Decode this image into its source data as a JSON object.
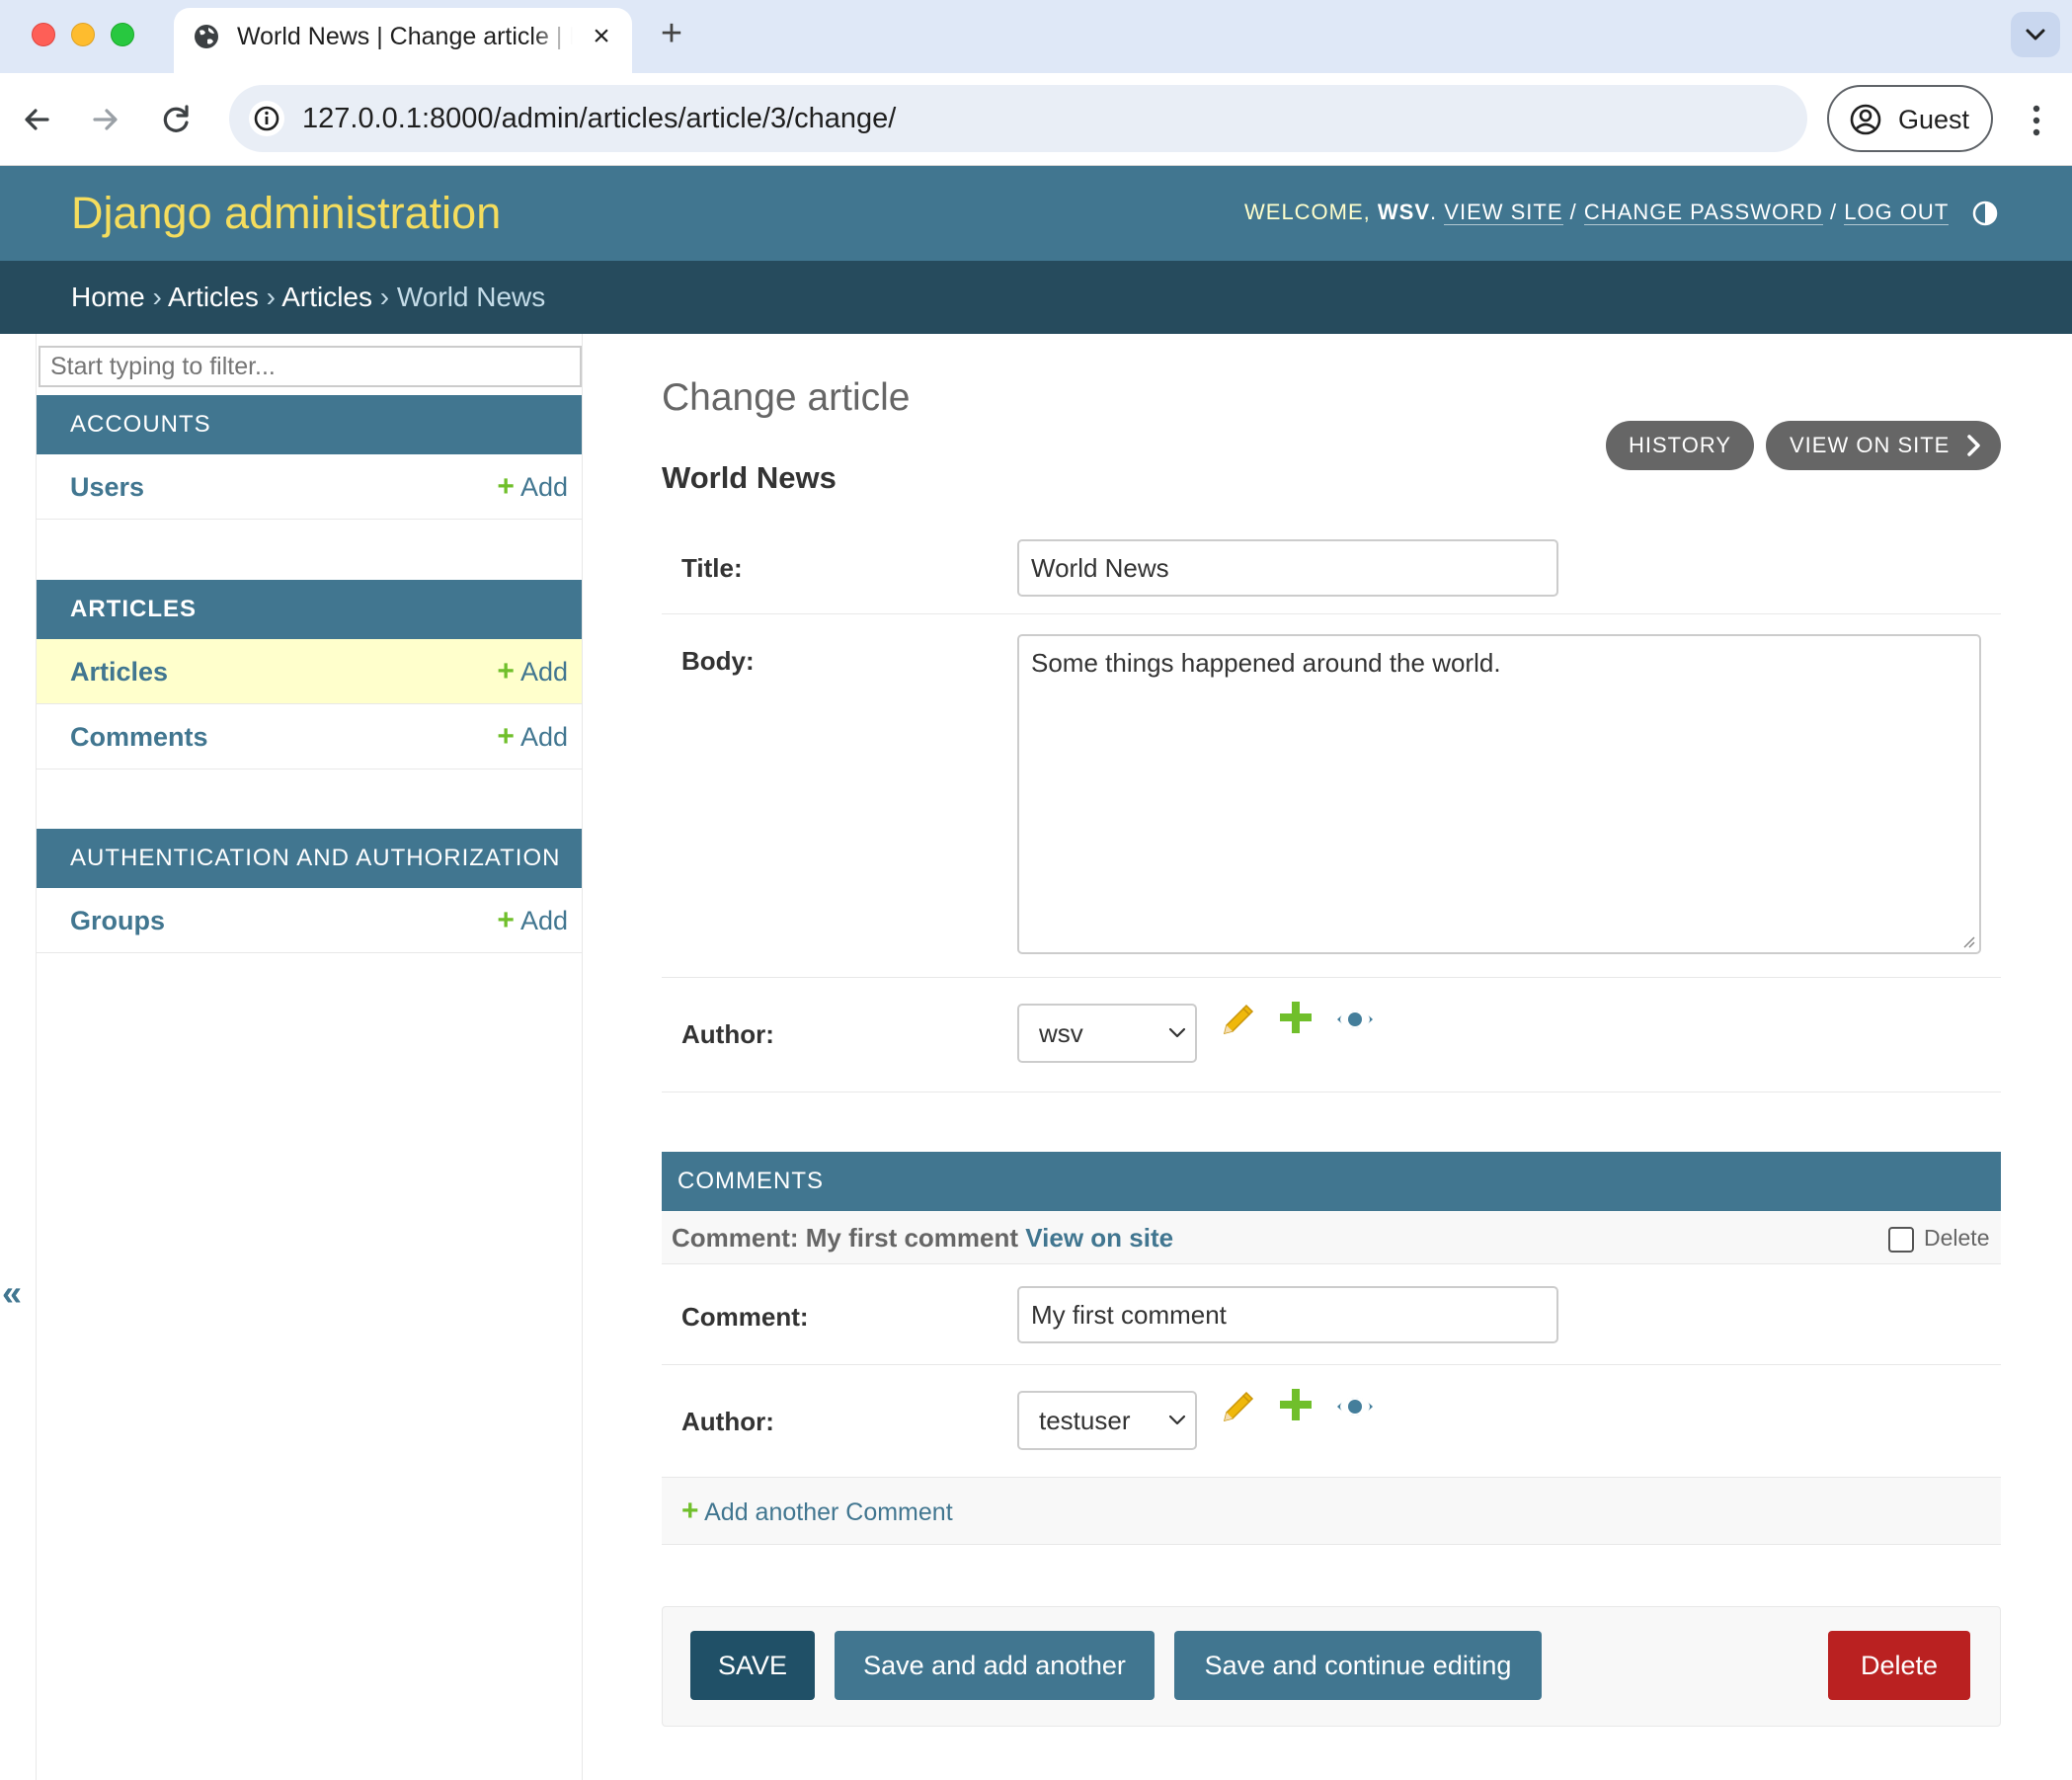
{
  "browser": {
    "tab_title": "World News | Change article | Django site admin",
    "url": "127.0.0.1:8000/admin/articles/article/3/change/",
    "profile_label": "Guest"
  },
  "header": {
    "branding": "Django administration",
    "welcome": "WELCOME,",
    "username": "WSV",
    "view_site": "VIEW SITE",
    "change_password": "CHANGE PASSWORD",
    "log_out": "LOG OUT"
  },
  "breadcrumbs": {
    "home": "Home",
    "app": "Articles",
    "model": "Articles",
    "current": "World News"
  },
  "sidebar": {
    "filter_placeholder": "Start typing to filter...",
    "add_label": "Add",
    "modules": [
      {
        "caption": "ACCOUNTS",
        "models": [
          {
            "name": "Users"
          }
        ]
      },
      {
        "caption": "ARTICLES",
        "models": [
          {
            "name": "Articles",
            "current": true
          },
          {
            "name": "Comments"
          }
        ]
      },
      {
        "caption": "AUTHENTICATION AND AUTHORIZATION",
        "models": [
          {
            "name": "Groups"
          }
        ]
      }
    ],
    "collapse_icon": "«"
  },
  "main": {
    "page_title": "Change article",
    "object_name": "World News",
    "tools": {
      "history": "HISTORY",
      "view_on_site": "VIEW ON SITE"
    },
    "fields": {
      "title_label": "Title:",
      "title_value": "World News",
      "body_label": "Body:",
      "body_value": "Some things happened around the world.",
      "author_label": "Author:",
      "author_value": "wsv"
    },
    "inline": {
      "caption": "COMMENTS",
      "item_title": "Comment: My first comment",
      "view_on_site": "View on site",
      "delete_label": "Delete",
      "comment_label": "Comment:",
      "comment_value": "My first comment",
      "author_label": "Author:",
      "author_value": "testuser",
      "add_another": "Add another Comment"
    },
    "submit": {
      "save": "SAVE",
      "save_add": "Save and add another",
      "save_continue": "Save and continue editing",
      "delete": "Delete"
    }
  },
  "colors": {
    "header": "#417690",
    "breadcrumbs": "#264b5d",
    "branding": "#f5dd5d",
    "add_plus": "#70bf2b",
    "delete": "#ba2121",
    "current_row": "#ffffcc"
  }
}
